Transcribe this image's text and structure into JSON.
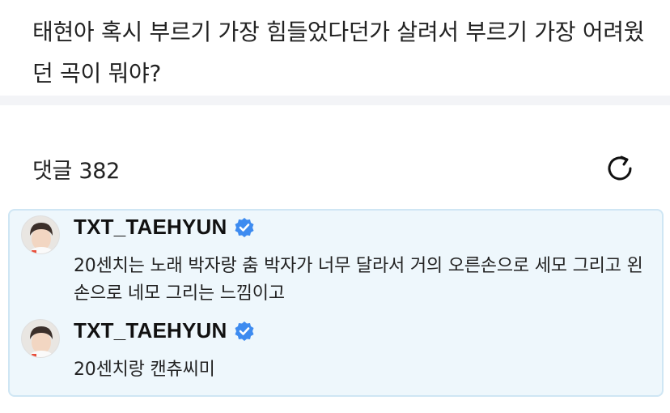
{
  "post": {
    "question": "태현아 혹시 부르기 가장 힘들었다던가 살려서 부르기  가장 어려웠던 곡이 뭐야?"
  },
  "comments": {
    "label": "댓글",
    "count": "382",
    "header_text": "댓글 382",
    "refresh_icon": "refresh-icon"
  },
  "artist_replies": [
    {
      "author": "TXT_TAEHYUN",
      "verified": true,
      "text": "20센치는 노래 박자랑 춤 박자가 너무 달라서 거의 오른손으로 세모 그리고 왼손으로 네모 그리는 느낌이고"
    },
    {
      "author": "TXT_TAEHYUN",
      "verified": true,
      "text": "20센치랑 캔츄씨미"
    }
  ],
  "colors": {
    "artist_box_bg": "#eef7fc",
    "artist_box_border": "#cfe6f4",
    "verified_badge": "#3d8bf0",
    "divider": "#f3f4f7"
  }
}
